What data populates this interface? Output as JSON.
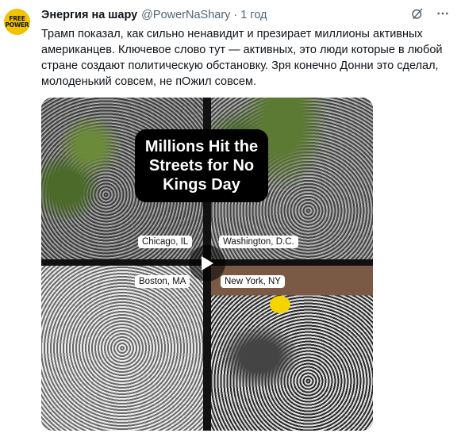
{
  "author": {
    "avatar_line1": "FREE",
    "avatar_line2": "POWER",
    "display_name": "Энергия на шару",
    "handle": "@PowerNaShary",
    "separator": "·",
    "time": "1 год"
  },
  "actions": {
    "grok_icon": "grok-icon",
    "more_icon": "more-icon"
  },
  "tweet": {
    "text": "Трамп показал, как сильно ненавидит и презирает миллионы активных американцев. Ключевое слово тут — активных, это люди которые в любой стране создают политическую обстановку. Зря конечно Донни это сделал, молоденький совсем, не пОжил совсем."
  },
  "media": {
    "headline": "Millions Hit the Streets for No Kings Day",
    "cities": {
      "chicago": "Chicago, IL",
      "washington": "Washington, D.C.",
      "boston": "Boston, MA",
      "new_york": "New York, NY"
    },
    "play_icon": "play-icon"
  },
  "colors": {
    "text_primary": "#0f1419",
    "text_secondary": "#536471",
    "avatar_bg": "#f2c200"
  }
}
